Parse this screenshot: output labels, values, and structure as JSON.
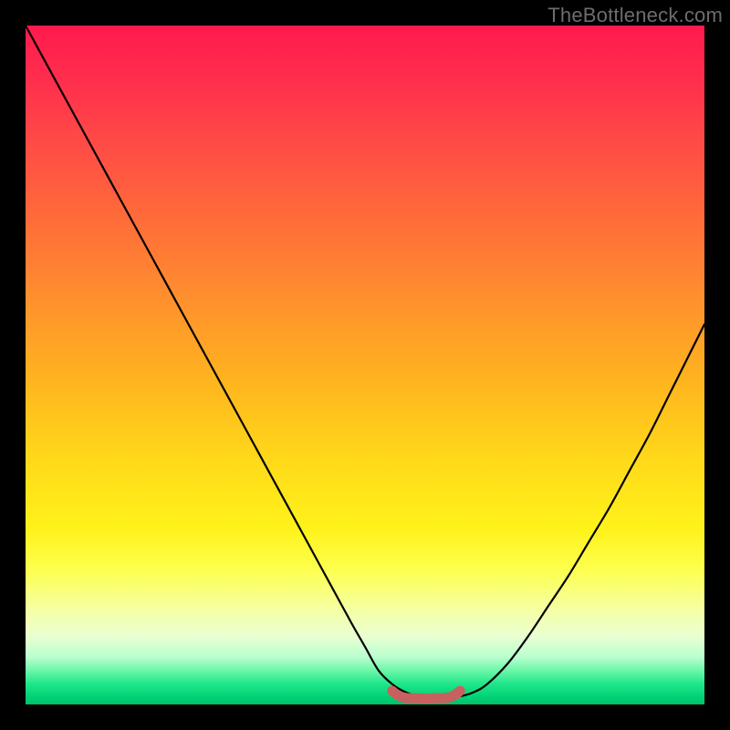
{
  "watermark": "TheBottleneck.com",
  "colors": {
    "frame": "#000000",
    "curve_stroke": "#000000",
    "marker_stroke": "#c86060",
    "marker_fill": "none"
  },
  "chart_data": {
    "type": "line",
    "title": "",
    "xlabel": "",
    "ylabel": "",
    "xlim": [
      0,
      100
    ],
    "ylim": [
      0,
      100
    ],
    "grid": false,
    "legend": false,
    "series": [
      {
        "name": "bottleneck-curve",
        "x": [
          0,
          3,
          6,
          9,
          12,
          15,
          18,
          21,
          24,
          27,
          30,
          33,
          36,
          39,
          42,
          45,
          48,
          50,
          52,
          54,
          56,
          58,
          60,
          62,
          64,
          66,
          68,
          71,
          74,
          77,
          80,
          83,
          86,
          89,
          92,
          95,
          98,
          100
        ],
        "values": [
          100,
          94.5,
          89,
          83.5,
          78,
          72.5,
          67,
          61.5,
          56,
          50.5,
          45,
          39.5,
          34,
          28.5,
          23,
          17.5,
          12,
          8.5,
          5,
          3,
          1.8,
          1.2,
          1,
          1,
          1.2,
          1.8,
          3,
          6,
          10,
          14.5,
          19,
          24,
          29,
          34.5,
          40,
          46,
          52,
          56
        ]
      }
    ],
    "annotations": [
      {
        "name": "optimal-range-marker",
        "type": "range-marker",
        "x_start": 54,
        "x_end": 64,
        "y": 1.2
      }
    ]
  }
}
